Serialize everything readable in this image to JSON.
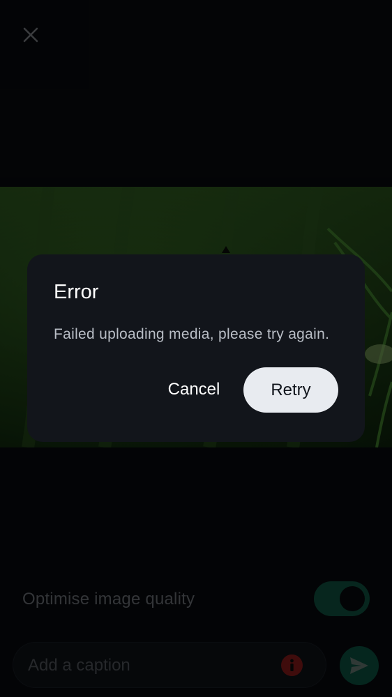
{
  "icons": {
    "close": "close-icon",
    "info": "info-icon",
    "send": "send-icon"
  },
  "settings": {
    "optimise_label": "Optimise image quality",
    "optimise_enabled": true
  },
  "composer": {
    "caption_placeholder": "Add a caption",
    "caption_value": ""
  },
  "dialog": {
    "title": "Error",
    "message": "Failed uploading media, please try again.",
    "cancel_label": "Cancel",
    "retry_label": "Retry"
  },
  "colors": {
    "accent": "#0b4a3b",
    "error": "#7a1818",
    "dialog_bg": "#12151b",
    "retry_bg": "#e8ebf0"
  }
}
